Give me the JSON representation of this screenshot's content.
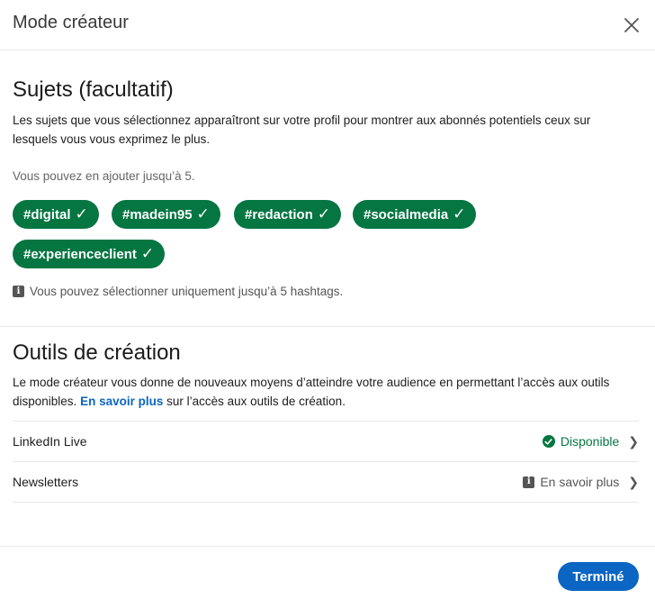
{
  "dialog": {
    "title": "Mode créateur"
  },
  "topics": {
    "title": "Sujets (facultatif)",
    "description": "Les sujets que vous sélectionnez apparaîtront sur votre profil pour montrer aux abonnés potentiels ceux sur lesquels vous vous exprimez le plus.",
    "limit_hint": "Vous pouvez en ajouter jusqu’à 5.",
    "chips": [
      {
        "label": "#digital",
        "check": "✓"
      },
      {
        "label": "#madein95",
        "check": "✓"
      },
      {
        "label": "#redaction",
        "check": "✓"
      },
      {
        "label": "#socialmedia",
        "check": "✓"
      },
      {
        "label": "#experienceclient",
        "check": "✓"
      }
    ],
    "info": "Vous pouvez sélectionner uniquement jusqu’à 5 hashtags.",
    "info_icon": "info-icon"
  },
  "tools": {
    "title": "Outils de création",
    "description_part1": "Le mode créateur vous donne de nouveaux moyens d’atteindre votre audience en permettant l’accès aux outils disponibles. ",
    "learn_more_link": "En savoir plus",
    "description_part2": " sur l’accès aux outils de création.",
    "rows": [
      {
        "name": "LinkedIn Live",
        "status": "Disponible",
        "status_icon": "check-circle-icon"
      },
      {
        "name": "Newsletters",
        "status": "En savoir plus",
        "status_icon": "info-icon"
      }
    ]
  },
  "footer": {
    "done_label": "Terminé"
  },
  "colors": {
    "accent": "#0a66c2",
    "chip": "#057642",
    "available": "#057642"
  }
}
